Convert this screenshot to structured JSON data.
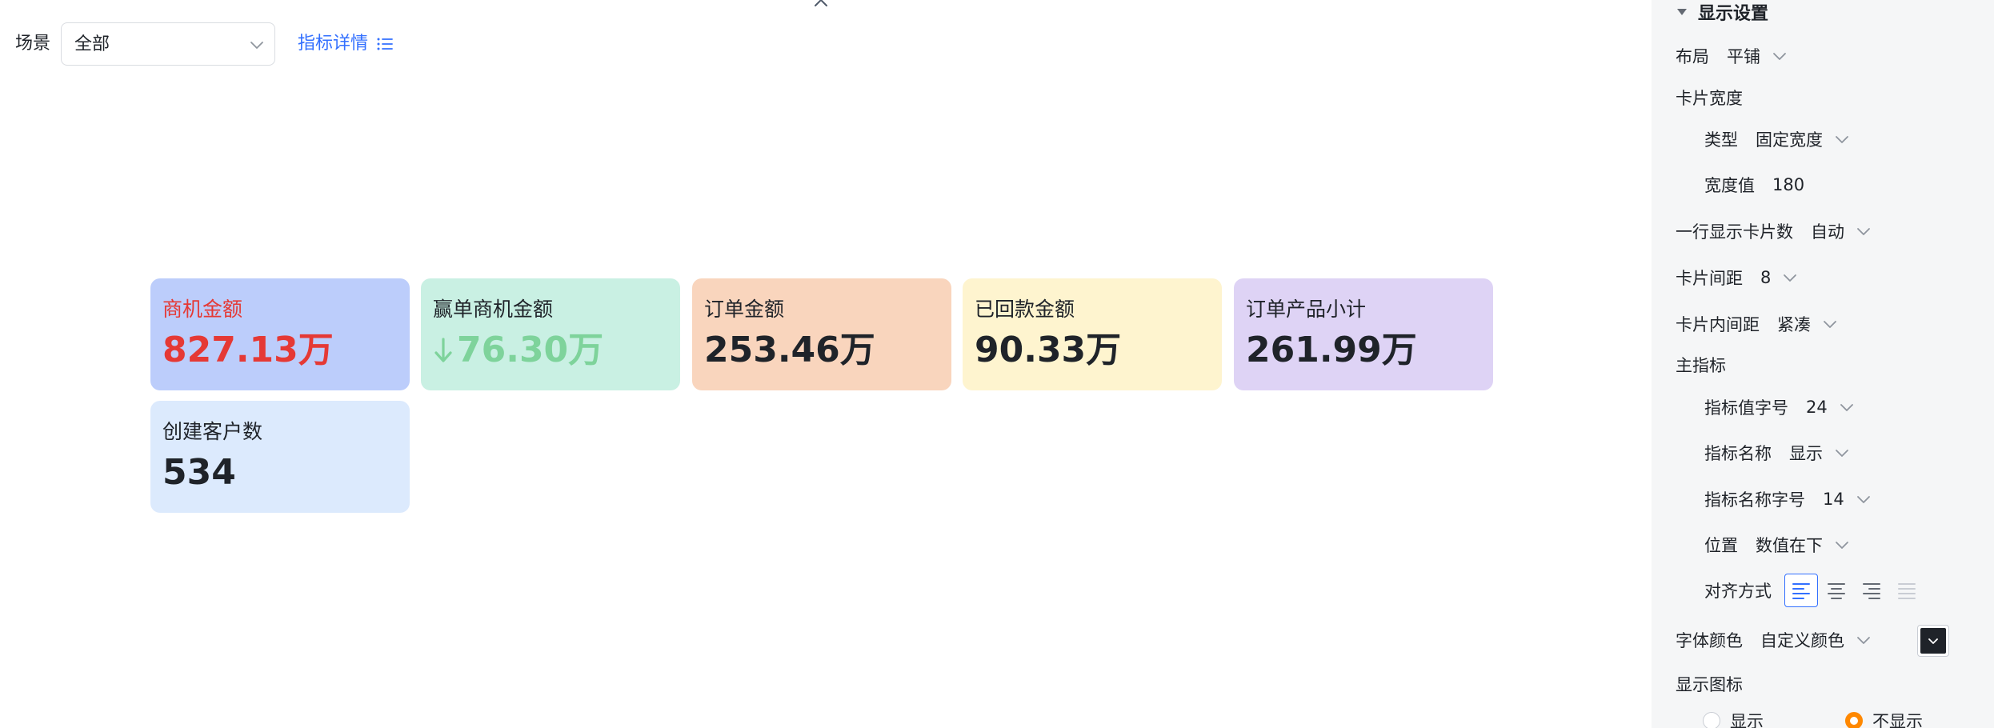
{
  "filter": {
    "scene_label": "场景",
    "scene_value": "全部",
    "detail_link": "指标详情"
  },
  "cards": [
    {
      "name": "商机金额",
      "value": "827.13万",
      "bg": "#bccdfb",
      "name_color": "#e53935",
      "value_color": "#e53935"
    },
    {
      "name": "赢单商机金额",
      "value": "76.30万",
      "bg": "#c9f0e3",
      "name_color": "#1f2329",
      "value_color": "#7ed39b",
      "trend": "down"
    },
    {
      "name": "订单金额",
      "value": "253.46万",
      "bg": "#f9d5bd",
      "name_color": "#1f2329",
      "value_color": "#1f2329"
    },
    {
      "name": "已回款金额",
      "value": "90.33万",
      "bg": "#fef4cf",
      "name_color": "#1f2329",
      "value_color": "#1f2329"
    },
    {
      "name": "订单产品小计",
      "value": "261.99万",
      "bg": "#ded3f5",
      "name_color": "#1f2329",
      "value_color": "#1f2329"
    },
    {
      "name": "创建客户数",
      "value": "534",
      "bg": "#dceafd",
      "name_color": "#1f2329",
      "value_color": "#1f2329"
    }
  ],
  "settings": {
    "title": "显示设置",
    "layout_label": "布局",
    "layout_value": "平铺",
    "card_width_label": "卡片宽度",
    "type_label": "类型",
    "type_value": "固定宽度",
    "width_value_label": "宽度值",
    "width_value": "180",
    "per_row_label": "一行显示卡片数",
    "per_row_value": "自动",
    "card_gap_label": "卡片间距",
    "card_gap_value": "8",
    "card_padding_label": "卡片内间距",
    "card_padding_value": "紧凑",
    "main_metric_label": "主指标",
    "value_font_label": "指标值字号",
    "value_font_value": "24",
    "metric_name_label": "指标名称",
    "metric_name_value": "显示",
    "name_font_label": "指标名称字号",
    "name_font_value": "14",
    "position_label": "位置",
    "position_value": "数值在下",
    "align_label": "对齐方式",
    "font_color_label": "字体颜色",
    "font_color_value": "自定义颜色",
    "font_color": "#1f2329",
    "show_icon_label": "显示图标",
    "radio_show": "显示",
    "radio_hide": "不显示",
    "accent": "#3370ff"
  }
}
